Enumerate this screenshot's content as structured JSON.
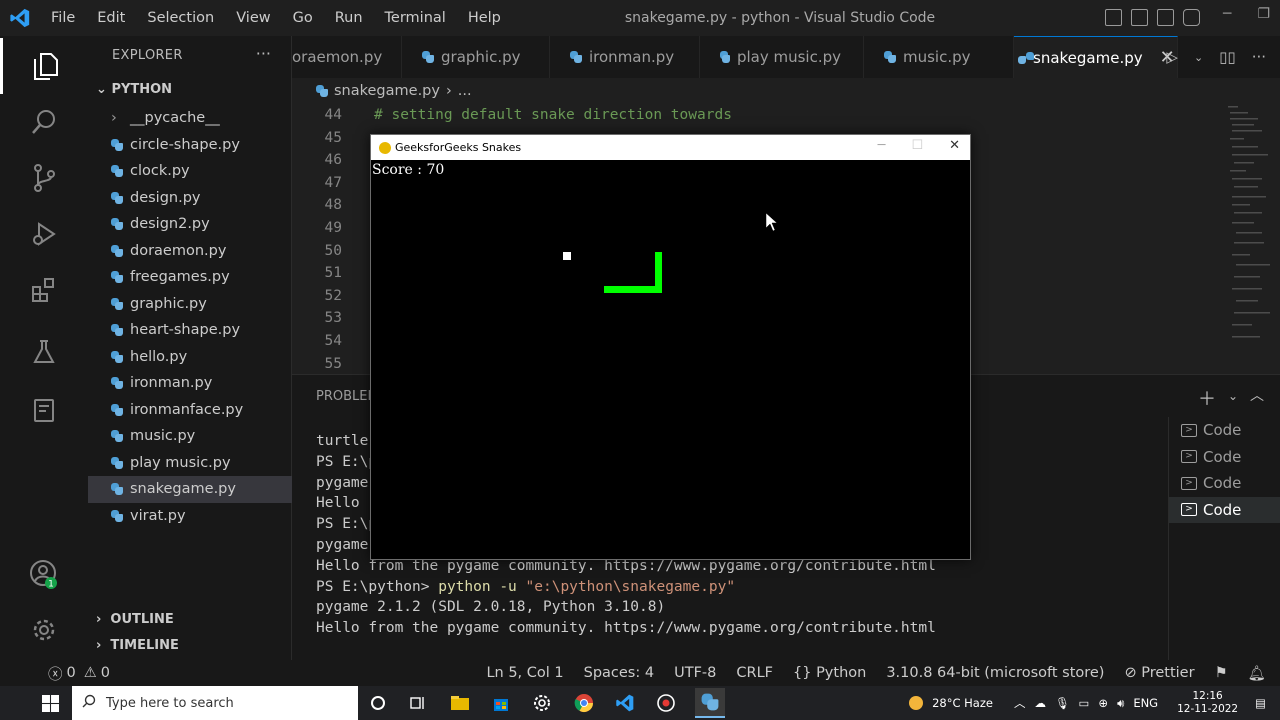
{
  "titlebar": {
    "menu": [
      "File",
      "Edit",
      "Selection",
      "View",
      "Go",
      "Run",
      "Terminal",
      "Help"
    ],
    "title": "snakegame.py - python - Visual Studio Code"
  },
  "sidebar": {
    "header": "EXPLORER",
    "folder": "PYTHON",
    "items": [
      {
        "label": "__pycache__",
        "type": "folder"
      },
      {
        "label": "circle-shape.py",
        "type": "py"
      },
      {
        "label": "clock.py",
        "type": "py"
      },
      {
        "label": "design.py",
        "type": "py"
      },
      {
        "label": "design2.py",
        "type": "py"
      },
      {
        "label": "doraemon.py",
        "type": "py"
      },
      {
        "label": "freegames.py",
        "type": "py"
      },
      {
        "label": "graphic.py",
        "type": "py"
      },
      {
        "label": "heart-shape.py",
        "type": "py"
      },
      {
        "label": "hello.py",
        "type": "py"
      },
      {
        "label": "ironman.py",
        "type": "py"
      },
      {
        "label": "ironmanface.py",
        "type": "py"
      },
      {
        "label": "music.py",
        "type": "py"
      },
      {
        "label": "play music.py",
        "type": "py"
      },
      {
        "label": "snakegame.py",
        "type": "py",
        "selected": true
      },
      {
        "label": "virat.py",
        "type": "py"
      }
    ],
    "outline": "OUTLINE",
    "timeline": "TIMELINE"
  },
  "tabs": [
    {
      "label": "oraemon.py"
    },
    {
      "label": "graphic.py"
    },
    {
      "label": "ironman.py"
    },
    {
      "label": "play music.py"
    },
    {
      "label": "music.py"
    },
    {
      "label": "snakegame.py",
      "active": true
    }
  ],
  "breadcrumb": {
    "file": "snakegame.py",
    "rest": "..."
  },
  "editor": {
    "line_numbers": [
      "44",
      "45",
      "46",
      "47",
      "48",
      "49",
      "50",
      "51",
      "52",
      "53",
      "54",
      "55"
    ],
    "visible_code": "# setting default snake direction towards"
  },
  "panel": {
    "tab_label": "PROBLEM",
    "terminal_lines": [
      {
        "text": "turtle",
        "kind": "plain"
      },
      {
        "text": "PS E:\\p",
        "kind": "plain"
      },
      {
        "text": "pygame",
        "kind": "plain"
      },
      {
        "text": "Hello ",
        "kind": "plain"
      },
      {
        "text": "PS E:\\p",
        "kind": "plain"
      },
      {
        "text": "pygame",
        "kind": "plain"
      },
      {
        "text": "Hello from the pygame community. https://www.pygame.org/contribute.html",
        "kind": "plain"
      },
      {
        "prompt": "PS E:\\python> ",
        "cmd": "python -u ",
        "arg": "\"e:\\python\\snakegame.py\"",
        "kind": "command"
      },
      {
        "text": "pygame 2.1.2 (SDL 2.0.18, Python 3.10.8)",
        "kind": "plain"
      },
      {
        "text": "Hello from the pygame community. https://www.pygame.org/contribute.html",
        "kind": "plain"
      }
    ],
    "terminals": [
      "Code",
      "Code",
      "Code",
      "Code"
    ]
  },
  "pygame": {
    "title": "GeeksforGeeks Snakes",
    "score_text": "Score : 70",
    "snake_color": "#00ff00",
    "fruit_color": "#ffffff",
    "background": "#000000"
  },
  "statusbar": {
    "errors": "0",
    "warnings": "0",
    "position": "Ln 5, Col 1",
    "spaces": "Spaces: 4",
    "encoding": "UTF-8",
    "eol": "CRLF",
    "language": "Python",
    "interpreter": "3.10.8 64-bit (microsoft store)",
    "formatter": "Prettier"
  },
  "taskbar": {
    "search_placeholder": "Type here to search",
    "weather": "28°C  Haze",
    "lang": "ENG",
    "time": "12:16",
    "date": "12-11-2022"
  },
  "colors": {
    "accent": "#0078d4",
    "editor_bg": "#1f1f1f",
    "sidebar_bg": "#181818",
    "badge_green": "#16a34a"
  }
}
